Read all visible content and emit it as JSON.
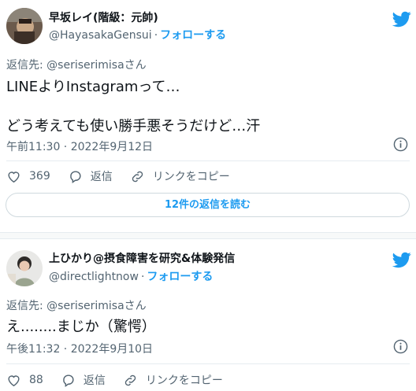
{
  "tweets": [
    {
      "display_name": "早坂レイ(階級：元帥)",
      "handle": "@HayasakaGensui",
      "follow_label": "フォローする",
      "replying_to": "返信先: @seriserimisaさん",
      "body_lines": [
        "LINEよりInstagramって…",
        "どう考えても使い勝手悪そうだけど…汗"
      ],
      "timestamp": "午前11:30 · 2022年9月12日",
      "like_count": "369",
      "reply_label": "返信",
      "copy_link_label": "リンクをコピー",
      "read_replies_label": "12件の返信を読む"
    },
    {
      "display_name": "上ひかり@摂食障害を研究&体験発信",
      "handle": "@directlightnow",
      "follow_label": "フォローする",
      "replying_to": "返信先: @seriserimisaさん",
      "body_lines": [
        "え........まじか（驚愕）"
      ],
      "timestamp": "午後11:32 · 2022年9月10日",
      "like_count": "88",
      "reply_label": "返信",
      "copy_link_label": "リンクをコピー"
    }
  ],
  "icons": [
    "twitter-bird-icon",
    "info-icon",
    "heart-icon",
    "reply-icon",
    "link-icon"
  ],
  "colors": {
    "accent": "#1d9bf0",
    "text": "#0f1419",
    "muted": "#536471",
    "border": "#cfd9de"
  }
}
